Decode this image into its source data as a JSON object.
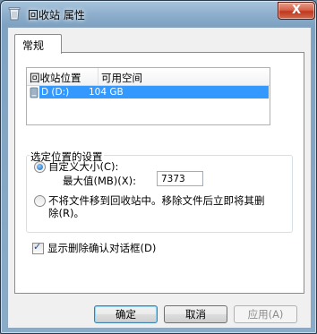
{
  "window": {
    "title": "回收站 属性",
    "close_label": "X"
  },
  "tabs": [
    {
      "label": "常规",
      "selected": true
    }
  ],
  "listview": {
    "columns": [
      "回收站位置",
      "可用空间"
    ],
    "rows": [
      {
        "location": "D (D:)",
        "free_space": "104 GB",
        "selected": true
      }
    ]
  },
  "settings": {
    "group_label": "选定位置的设置",
    "custom_size_label": "自定义大小(C):",
    "custom_size_selected": true,
    "max_value_label": "最大值(MB)(X):",
    "max_value": "7373",
    "no_recycle_label_line1": "不将文件移到回收站中。移除文件后立即将其删",
    "no_recycle_label_line2": "除(R)。",
    "no_recycle_selected": false
  },
  "confirm_delete": {
    "label": "显示删除确认对话框(D)",
    "checked": true
  },
  "buttons": {
    "ok": "确定",
    "cancel": "取消",
    "apply": "应用(A)"
  },
  "colors": {
    "selection": "#3399ff",
    "title_bar": "#8fb0cd",
    "close_button": "#c0391f"
  }
}
